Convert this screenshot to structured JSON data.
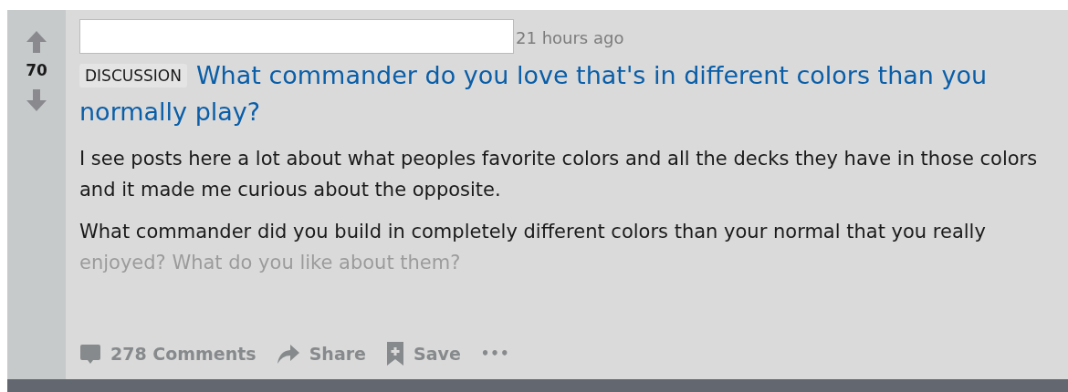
{
  "post": {
    "score": "70",
    "timestamp": "21 hours ago",
    "flair": "DISCUSSION",
    "title": "What commander do you love that's in different colors than you normally play?",
    "body": [
      "I see posts here a lot about what peoples favorite colors and all the decks they have in those colors and it made me curious about the opposite.",
      "What commander did you build in completely different colors than your normal that you really enjoyed? What do you like about them?"
    ],
    "actions": [
      {
        "kind": "comments",
        "label": "278 Comments"
      },
      {
        "kind": "share",
        "label": "Share"
      },
      {
        "kind": "save",
        "label": "Save"
      },
      {
        "kind": "more",
        "label": "•••"
      }
    ]
  }
}
